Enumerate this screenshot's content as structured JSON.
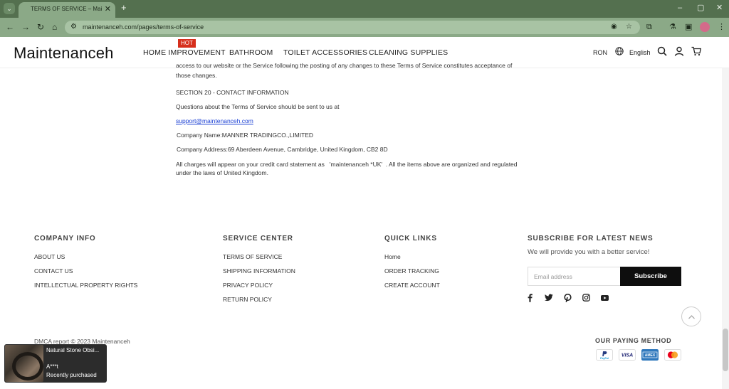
{
  "browser": {
    "tab_title": "TERMS OF SERVICE – Maintenanceh",
    "tab_list_icon": "chevron-down-icon",
    "new_tab": "+",
    "url": "maintenanceh.com/pages/terms-of-service",
    "window_controls": [
      "–",
      "▢",
      "✕"
    ]
  },
  "header": {
    "logo": "Maintenanceh",
    "nav": [
      {
        "label": "HOME IMPROVEMENT",
        "badge": "HOT"
      },
      {
        "label": "BATHROOM"
      },
      {
        "label": "TOILET ACCESSORIES"
      },
      {
        "label": "CLEANING SUPPLIES"
      }
    ],
    "currency": "RON",
    "language": "English"
  },
  "content": {
    "clipped_line_1": "access to our website or the Service following the posting of any changes to these Terms of Service constitutes acceptance of",
    "clipped_line_2": "those changes.",
    "section_heading": "SECTION 20 - CONTACT INFORMATION",
    "questions": "Questions about the Terms of Service should be sent to us at",
    "email": "support@maintenanceh.com",
    "company_name": "Company Name:MANNER TRADINGCO.,LIMITED",
    "company_address": "Company Address:69 Aberdeen Avenue, Cambridge, United Kingdom, CB2 8D",
    "charges_line_1": "All charges will appear on your credit card statement as   'maintenanceh *UK'  . All the items above are organized and regulated",
    "charges_line_2": "under the laws of United Kingdom."
  },
  "footer": {
    "company_info": {
      "title": "COMPANY INFO",
      "links": [
        "ABOUT US",
        "CONTACT US",
        "INTELLECTUAL PROPERTY RIGHTS"
      ]
    },
    "service_center": {
      "title": "SERVICE CENTER",
      "links": [
        "TERMS OF SERVICE",
        "SHIPPING INFORMATION",
        "PRIVACY POLICY",
        "RETURN POLICY"
      ]
    },
    "quick_links": {
      "title": "QUICK LINKS",
      "links": [
        "Home",
        "ORDER TRACKING",
        "CREATE ACCOUNT"
      ]
    },
    "newsletter": {
      "title": "SUBSCRIBE FOR LATEST NEWS",
      "text": "We will provide you with a better service!",
      "placeholder": "Email address",
      "button": "Subscribe"
    },
    "social_icons": [
      "facebook-icon",
      "twitter-icon",
      "pinterest-icon",
      "instagram-icon",
      "youtube-icon"
    ],
    "copyright": "DMCA report © 2023 Maintenanceh",
    "paying_title": "OUR PAYING METHOD",
    "payment_methods": [
      {
        "name": "PayPal",
        "color": "#ffffff"
      },
      {
        "name": "VISA",
        "color": "#ffffff"
      },
      {
        "name": "AMEX",
        "color": "#2e77bc"
      },
      {
        "name": "Mastercard",
        "color": "#ffffff"
      }
    ]
  },
  "popup": {
    "title": "Natural Stone Obsi...",
    "user": "A***t",
    "status": "Recently purchased"
  },
  "colors": {
    "chrome_dark": "#54704f",
    "chrome_light": "#8ba987",
    "hot_badge": "#d62f1c",
    "link": "#1a3fd4",
    "subscribe": "#0e0e0e"
  }
}
